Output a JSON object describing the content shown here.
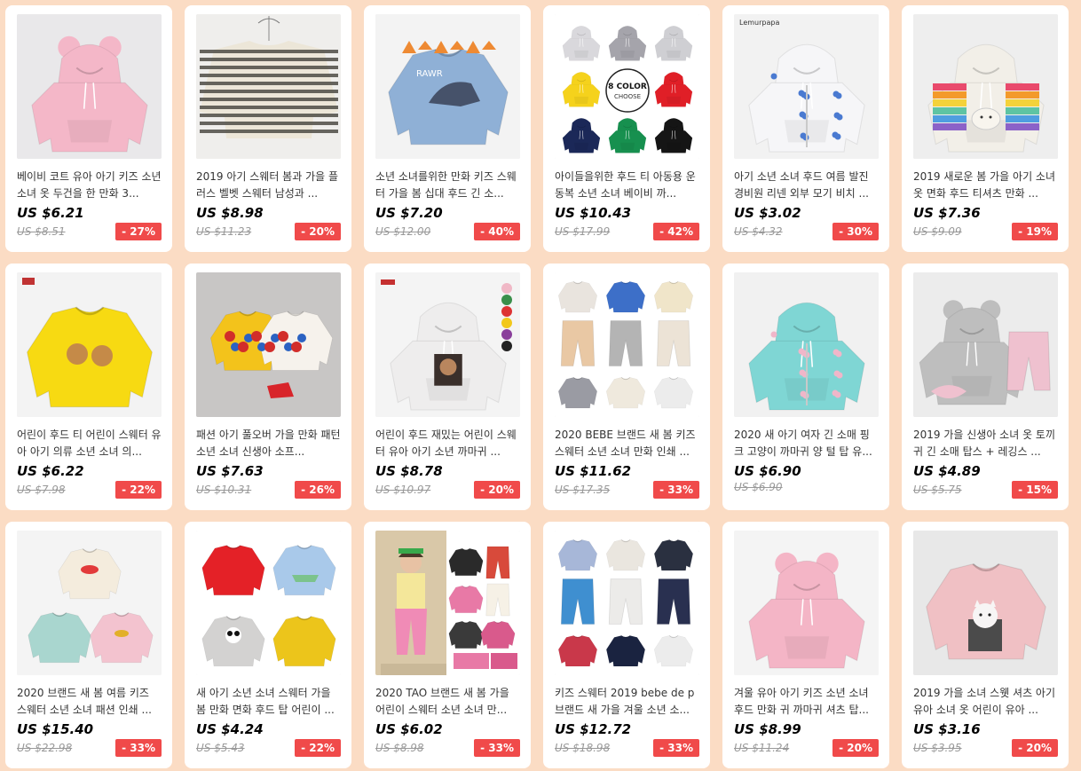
{
  "products": [
    {
      "title": "베이비 코트 유아 아기 키즈 소년 소녀 옷 두건을 한 만화 3...",
      "price": "US $6.21",
      "original": "US $8.51",
      "discount": "- 27%",
      "image": {
        "kind": "hoodie",
        "bg": "#e9e8ea",
        "color": "#f4b7c8",
        "ears": true
      }
    },
    {
      "title": "2019 아기 스웨터 봄과 가을 플러스 벨벳 스웨터 남성과 ...",
      "price": "US $8.98",
      "original": "US $11.23",
      "discount": "- 20%",
      "image": {
        "kind": "striped",
        "bg": "#efeeec",
        "color": "#ece6d8",
        "accent": "#4d4b45"
      }
    },
    {
      "title": "소년 소녀를위한 만화 키즈 스웨터 가을 봄 십대 후드 긴 소...",
      "price": "US $7.20",
      "original": "US $12.00",
      "discount": "- 40%",
      "image": {
        "kind": "dino",
        "bg": "#f3f3f3",
        "color": "#8fb0d6",
        "accent": "#ee8a33"
      }
    },
    {
      "title": "아이들을위한 후드 티 아동용 운동복 소년 소녀 베이비 까...",
      "price": "US $10.43",
      "original": "US $17.99",
      "discount": "- 42%",
      "image": {
        "kind": "multi",
        "bg": "#ffffff",
        "colors": [
          "#d9d8dc",
          "#a5a4ab",
          "#cfcfd3",
          "#f5d21c",
          "#f5d21c",
          "#e01f27",
          "#1b2858",
          "#17904f",
          "#151515"
        ]
      }
    },
    {
      "title": "아기 소년 소녀 후드 여름 발진 경비원 리넨 외부 모기 비치 ...",
      "price": "US $3.02",
      "original": "US $4.32",
      "discount": "- 30%",
      "image": {
        "kind": "jacket",
        "bg": "#f2f2f2",
        "color": "#f6f6f8",
        "accent": "#4a7ad1",
        "tag": "Lemurpapa"
      }
    },
    {
      "title": "2019 새로운 봄 가을 아기 소녀 옷 면화 후드 티셔츠 만화 ...",
      "price": "US $7.36",
      "original": "US $9.09",
      "discount": "- 19%",
      "image": {
        "kind": "rainbow",
        "bg": "#eeeeee",
        "color": "#f2efe8"
      }
    },
    {
      "title": "어린이 후드 티 어린이 스웨터 유아 아기 의류 소년 소녀 의...",
      "price": "US $6.22",
      "original": "US $7.98",
      "discount": "- 22%",
      "image": {
        "kind": "sweat",
        "bg": "#f3f3f3",
        "color": "#f7da12",
        "accent": "#c58a48"
      }
    },
    {
      "title": "패션 아기 풀오버 가을 만화 패턴 소년 소녀 신생아 소프...",
      "price": "US $7.63",
      "original": "US $10.31",
      "discount": "- 26%",
      "image": {
        "kind": "elmo",
        "bg": "#c8c6c5",
        "color": "#f3c31b",
        "accent": "#d22d2a"
      }
    },
    {
      "title": "어린이 후드 재밌는 어린이 스웨터 유아 아기 소년 까마귀 ...",
      "price": "US $8.78",
      "original": "US $10.97",
      "discount": "- 20%",
      "image": {
        "kind": "hoodie",
        "bg": "#f4f4f4",
        "color": "#eeeded",
        "ears": false,
        "print": true
      }
    },
    {
      "title": "2020 BEBE 브랜드 새 봄 키즈 스웨터 소년 소녀 만화 인쇄 ...",
      "price": "US $11.62",
      "original": "US $17.35",
      "discount": "- 33%",
      "image": {
        "kind": "set",
        "bg": "#ffffff",
        "colors": [
          "#e9e4de",
          "#3d6fc8",
          "#f0e5c9",
          "#e9c8a4",
          "#b4b4b4",
          "#ece3d6",
          "#9a9ba3",
          "#efe9dd",
          "#ececec"
        ]
      }
    },
    {
      "title": "2020 새 아기 여자 긴 소매 핑크 고양이 까마귀 양 털 탑 유...",
      "price": "US $6.90",
      "original": "US $6.90",
      "discount": "",
      "image": {
        "kind": "jacket",
        "bg": "#f1f1f1",
        "color": "#7fd6d4",
        "accent": "#f0b6c9",
        "tag": ""
      }
    },
    {
      "title": "2019 가을 신생아 소녀 옷 토끼 귀 긴 소매 탑스 + 레깅스 ...",
      "price": "US $4.89",
      "original": "US $5.75",
      "discount": "- 15%",
      "image": {
        "kind": "outfit",
        "bg": "#ececec",
        "color": "#bebebe",
        "accent": "#efc1cf"
      }
    },
    {
      "title": "2020 브랜드 새 봄 여름 키즈 스웨터 소년 소녀 패션 인쇄 ...",
      "price": "US $15.40",
      "original": "US $22.98",
      "discount": "- 33%",
      "image": {
        "kind": "trio",
        "bg": "#f4f4f4",
        "colors": [
          "#f4ecdd",
          "#a9d6cf",
          "#f3c3cf"
        ]
      }
    },
    {
      "title": "새 아기 소년 소녀 스웨터 가을 봄 만화 면화 후드 탑 어린이 ...",
      "price": "US $4.24",
      "original": "US $5.43",
      "discount": "- 22%",
      "image": {
        "kind": "quad",
        "bg": "#ffffff",
        "colors": [
          "#e42127",
          "#a9c9ea",
          "#d3d2d1",
          "#ecc51b"
        ]
      }
    },
    {
      "title": "2020 TAO 브랜드 새 봄 가을 어린이 스웨터 소년 소녀 만...",
      "price": "US $6.02",
      "original": "US $8.98",
      "discount": "- 33%",
      "image": {
        "kind": "model",
        "bg": "#ffffff",
        "colors": [
          "#f08bb6",
          "#2a2a2a",
          "#d84a3b",
          "#e879a6",
          "#f6f1e6",
          "#3a3a3a",
          "#d95a8c"
        ]
      }
    },
    {
      "title": "키즈 스웨터 2019 bebe de p 브랜드 새 가을 겨울 소년 소...",
      "price": "US $12.72",
      "original": "US $18.98",
      "discount": "- 33%",
      "image": {
        "kind": "set",
        "bg": "#ffffff",
        "colors": [
          "#a7b7d8",
          "#eae6df",
          "#2a3040",
          "#3f8fd0",
          "#ecebe9",
          "#293050",
          "#c9384a",
          "#1a2340",
          "#ececec"
        ]
      }
    },
    {
      "title": "겨울 유아 아기 키즈 소년 소녀 후드 만화 귀 까마귀 셔츠 탑...",
      "price": "US $8.99",
      "original": "US $11.24",
      "discount": "- 20%",
      "image": {
        "kind": "hoodie",
        "bg": "#f4f4f4",
        "color": "#f4b5c6",
        "ears": true
      }
    },
    {
      "title": "2019 가을 소녀 스웻 셔츠 아기 유아 소녀 옷 어린이 유아 ...",
      "price": "US $3.16",
      "original": "US $3.95",
      "discount": "- 20%",
      "image": {
        "kind": "cat",
        "bg": "#e8e8e8",
        "color": "#f0c0c4"
      }
    }
  ]
}
